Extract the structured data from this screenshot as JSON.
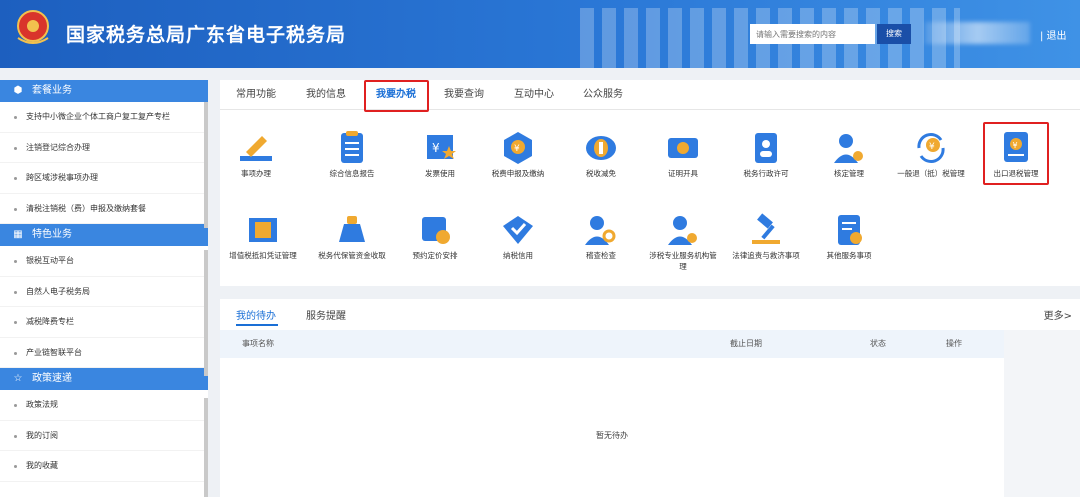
{
  "header": {
    "title": "国家税务总局广东省电子税务局",
    "emblem_text": "中国税务",
    "search_placeholder": "请输入需要搜索的内容",
    "search_button": "搜索",
    "logout": "| 退出"
  },
  "sidebar": {
    "sections": [
      {
        "title": "套餐业务",
        "icon": "cube-icon",
        "items": [
          "支持中小微企业个体工商户复工复产专栏",
          "注销登记综合办理",
          "跨区域涉税事项办理",
          "清税注销税（费）申报及缴纳套餐"
        ]
      },
      {
        "title": "特色业务",
        "icon": "grid-icon",
        "items": [
          "银税互动平台",
          "自然人电子税务局",
          "减税降费专栏",
          "产业链智联平台"
        ]
      },
      {
        "title": "政策速递",
        "icon": "star-icon",
        "items": [
          "政策法规",
          "我的订阅",
          "我的收藏"
        ]
      }
    ]
  },
  "tabs": [
    "常用功能",
    "我的信息",
    "我要办税",
    "我要查询",
    "互动中心",
    "公众服务"
  ],
  "active_tab": "我要办税",
  "services_row1": [
    {
      "label": "事项办理",
      "icon": "pencil-icon"
    },
    {
      "label": "综合信息报告",
      "icon": "clipboard-icon"
    },
    {
      "label": "发票使用",
      "icon": "invoice-icon"
    },
    {
      "label": "税费申报及缴纳",
      "icon": "tax-declare-icon"
    },
    {
      "label": "税收减免",
      "icon": "coins-icon"
    },
    {
      "label": "证明开具",
      "icon": "certificate-icon"
    },
    {
      "label": "税务行政许可",
      "icon": "permit-icon"
    },
    {
      "label": "核定管理",
      "icon": "user-gear-icon"
    },
    {
      "label": "一般退（抵）税管理",
      "icon": "refund-cycle-icon"
    },
    {
      "label": "出口退税管理",
      "icon": "export-refund-icon"
    }
  ],
  "services_row2": [
    {
      "label": "增值税抵扣凭证管理",
      "icon": "voucher-icon"
    },
    {
      "label": "税务代保管资金收取",
      "icon": "money-bag-icon"
    },
    {
      "label": "预约定价安排",
      "icon": "calendar-clock-icon"
    },
    {
      "label": "纳税信用",
      "icon": "credit-heart-icon"
    },
    {
      "label": "稽查检查",
      "icon": "inspect-icon"
    },
    {
      "label": "涉税专业服务机构管理",
      "icon": "agency-icon"
    },
    {
      "label": "法律追责与救济事项",
      "icon": "gavel-icon"
    },
    {
      "label": "其他服务事项",
      "icon": "other-service-icon"
    }
  ],
  "todo": {
    "tabs": [
      "我的待办",
      "服务提醒"
    ],
    "more": "更多>",
    "columns": [
      "事项名称",
      "截止日期",
      "状态",
      "操作"
    ],
    "empty_text": "暂无待办"
  },
  "colors": {
    "header_blue": "#2a77d6",
    "accent": "#1a6fd6",
    "highlight_red": "#e02020",
    "side_section": "#3a86e0"
  }
}
